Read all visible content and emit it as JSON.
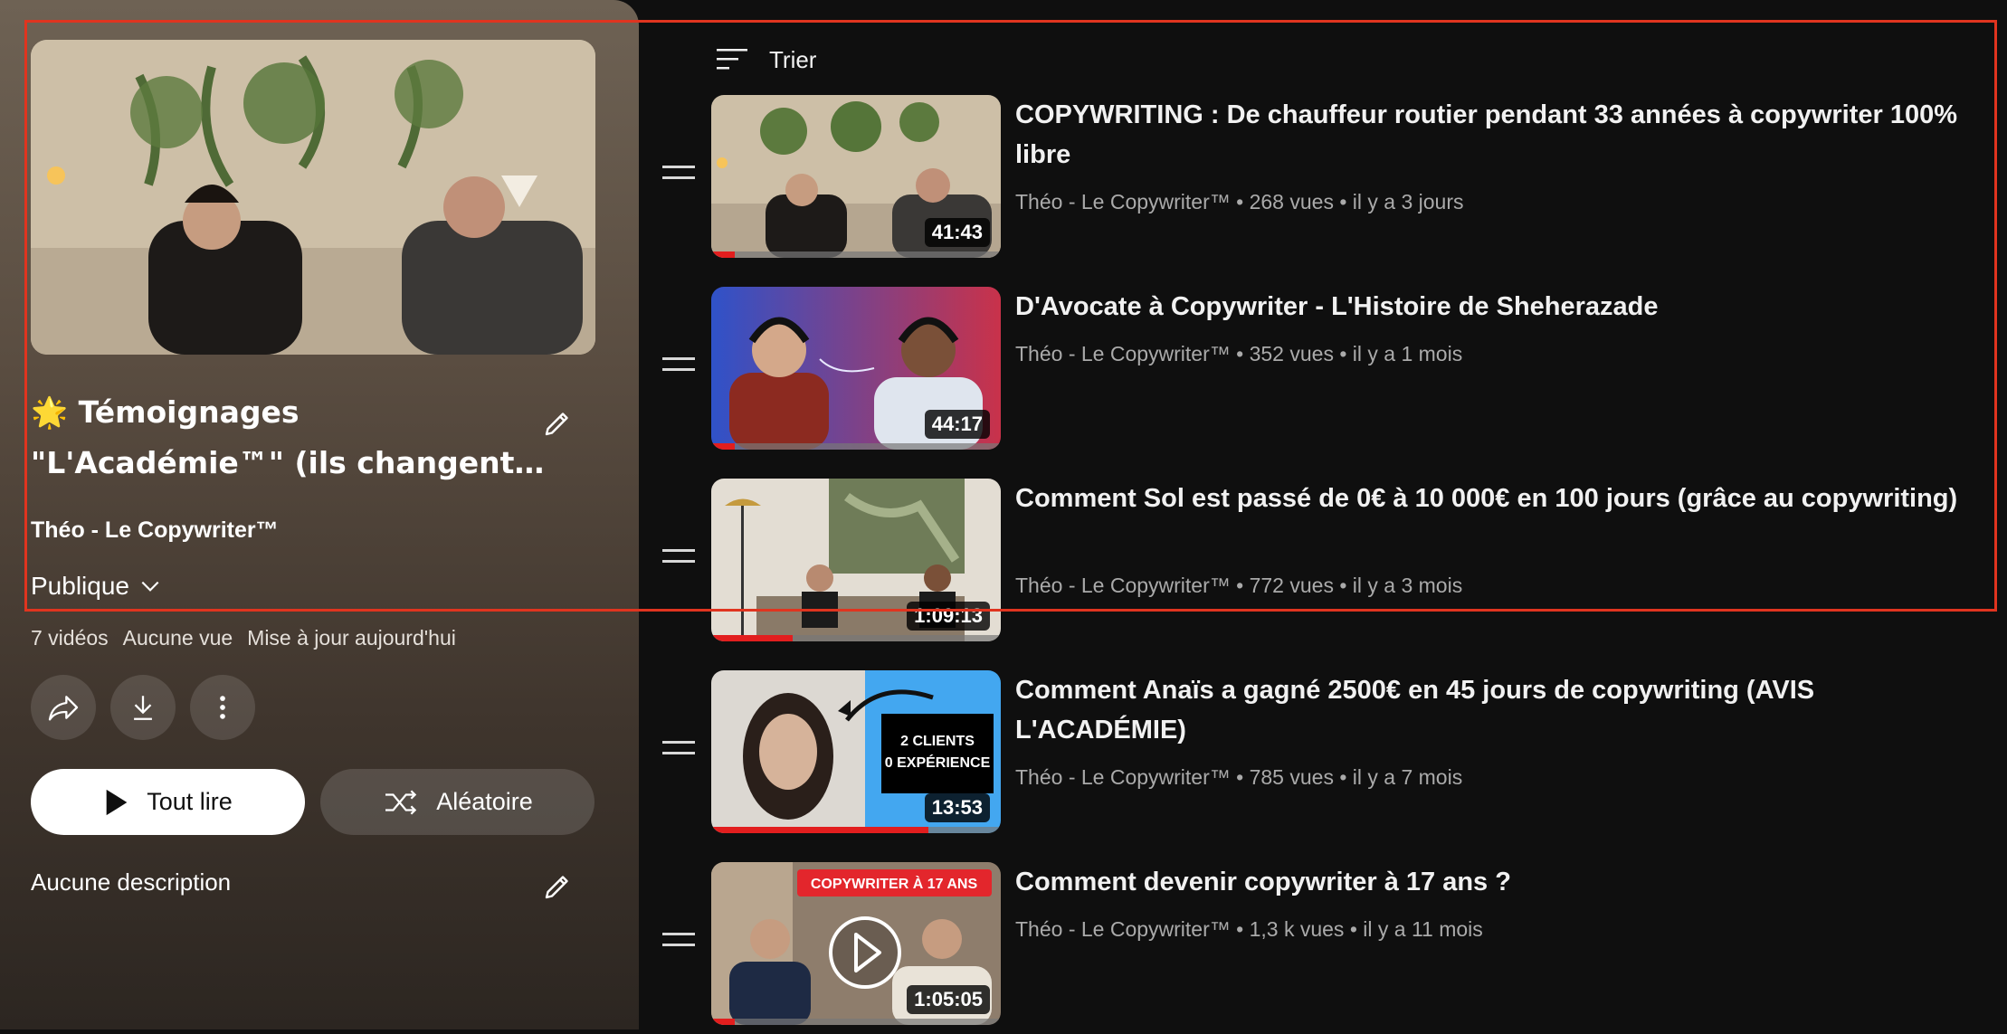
{
  "playlist": {
    "title_emoji": "🌟",
    "title_line1": "Témoignages",
    "title_line2": "\"L'Académie™\" (ils changent…",
    "owner": "Théo - Le Copywriter™",
    "privacy": "Publique",
    "video_count": "7 vidéos",
    "views": "Aucune vue",
    "updated": "Mise à jour aujourd'hui",
    "play_all_label": "Tout lire",
    "shuffle_label": "Aléatoire",
    "description": "Aucune description"
  },
  "sort_label": "Trier",
  "videos": [
    {
      "title": "COPYWRITING : De chauffeur routier pendant 33 années à copywriter 100% libre",
      "channel": "Théo - Le Copywriter™",
      "stats": "268 vues • il y a 3 jours",
      "duration": "41:43",
      "watched_fraction": 0.08
    },
    {
      "title": "D'Avocate à Copywriter - L'Histoire de Sheherazade",
      "channel": "Théo - Le Copywriter™",
      "stats": "352 vues • il y a 1 mois",
      "duration": "44:17",
      "watched_fraction": 0.08
    },
    {
      "title": "Comment Sol est passé de 0€ à 10 000€ en 100 jours (grâce au copywriting)",
      "channel": "Théo - Le Copywriter™",
      "stats": "772 vues • il y a 3 mois",
      "duration": "1:09:13",
      "watched_fraction": 0.28
    },
    {
      "title": "Comment Anaïs a gagné 2500€ en 45 jours de copywriting (AVIS L'ACADÉMIE)",
      "channel": "Théo - Le Copywriter™",
      "stats": "785 vues • il y a 7 mois",
      "duration": "13:53",
      "watched_fraction": 0.75,
      "thumb_text_1": "2 CLIENTS",
      "thumb_text_2": "0 EXPÉRIENCE"
    },
    {
      "title": "Comment devenir copywriter à 17 ans ?",
      "channel": "Théo - Le Copywriter™",
      "stats": "1,3 k vues • il y a 11 mois",
      "duration": "1:05:05",
      "watched_fraction": 0.08,
      "thumb_banner": "COPYWRITER À 17 ANS"
    }
  ],
  "colors": {
    "background": "#0f0f0f",
    "progress": "#e21e1e",
    "highlight_box": "#e0341f"
  }
}
